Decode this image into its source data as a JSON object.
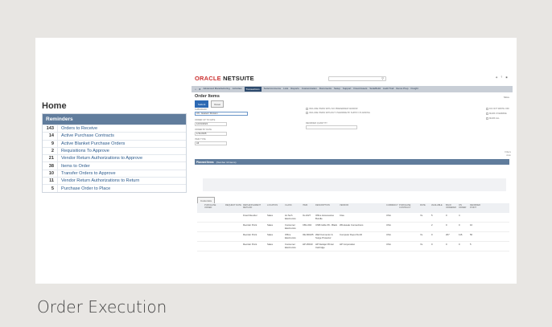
{
  "home": {
    "title": "Home",
    "panel_header": "Reminders",
    "items": [
      {
        "count": "143",
        "label": "Orders to Receive"
      },
      {
        "count": "14",
        "label": "Active Purchase Contracts"
      },
      {
        "count": "9",
        "label": "Active Blanket Purchase Orders"
      },
      {
        "count": "2",
        "label": "Requisitions To Approve"
      },
      {
        "count": "21",
        "label": "Vendor Return Authorizations to Approve"
      },
      {
        "count": "38",
        "label": "Items to Order"
      },
      {
        "count": "10",
        "label": "Transfer Orders to Approve"
      },
      {
        "count": "11",
        "label": "Vendor Return Authorizations to Return"
      },
      {
        "count": "5",
        "label": "Purchase Order to Place"
      }
    ]
  },
  "app": {
    "logo_main": "ORACLE",
    "logo_sub": " NETSUITE",
    "nav": [
      "Advanced Manufacturing",
      "Activities",
      "Transactions",
      "SuiteCommerce",
      "Lists",
      "Reports",
      "Customization",
      "Documents",
      "Setup",
      "Support",
      "Fixed Assets",
      "SuiteBuild",
      "Audit Trail",
      "Demo Prep",
      "Freight"
    ],
    "active_nav": "Transactions",
    "page_title": "Order Items",
    "more": "More",
    "buttons": {
      "submit": "Submit",
      "reset": "Reset"
    },
    "fields": [
      {
        "label": "SUBSIDIARY",
        "value": "US - Eastern Division"
      },
      {
        "label": "ORDER UP TO DATE",
        "value": "12/31/2024"
      },
      {
        "label": "ORDER BY DATE",
        "value": "1/31/2025"
      },
      {
        "label": "ITEM TYPE",
        "value": "All"
      },
      {
        "label": "REORDER QUANTITY",
        "value": ""
      }
    ],
    "checkboxes": [
      "INCLUDE ITEMS WITH NO PREFERRED VENDOR",
      "INCLUDE ITEMS WITHOUT OVERRIDE BY SUPPLY PLANNING",
      "DO NOT WRITE OFF",
      "MARK OVERRIDE",
      "MARK ALL"
    ],
    "section_title": "Planned Items",
    "section_count": "(Number 10 items)",
    "side_hint": "Filters\nAuto",
    "customize": "Customize",
    "grid_headers": [
      "",
      "PURCHASE ORDER",
      "REQUEST DATE",
      "REPLENISHMENT METHOD",
      "LOCATION",
      "CLASS",
      "ITEM",
      "DESCRIPTION",
      "VENDOR",
      "CURRENCY",
      "PURCHASE CONTRACT",
      "RATE",
      "AVAILABLE",
      "BACK ORDERED",
      "ON ORDER",
      "REORDER POINT"
    ],
    "grid_rows": [
      [
        "",
        "",
        "",
        "Fixed Reorder",
        "Sales",
        "Hi-Tech Electronics",
        "IG-1027",
        "Office Accessories Bundle",
        "Cisa",
        "USA",
        "",
        "7a",
        "5",
        "0",
        "4",
        ""
      ],
      [
        "",
        "",
        "",
        "Reorder Point",
        "Sales",
        "Consumer Electronics",
        "CBL-004",
        "USB Cable 6ft - Black",
        "Wholesale Connections",
        "USA",
        "",
        "",
        "2",
        "0",
        "0",
        "10"
      ],
      [
        "",
        "",
        "",
        "Reorder Point",
        "Sales",
        "Office Electronics",
        "OE-M0245",
        "Wall Connector & Surge Protector",
        "Computer Depot North",
        "USA",
        "",
        "7a",
        "0",
        "207",
        "116",
        "50"
      ],
      [
        "",
        "",
        "",
        "Reorder Point",
        "Sales",
        "Consumer Electronics",
        "HP-45010",
        "HP Deskjet Printer Cartridge",
        "HP Corporation",
        "USA",
        "",
        "7a",
        "0",
        "0",
        "0",
        "5"
      ]
    ]
  },
  "caption": "Order Execution"
}
